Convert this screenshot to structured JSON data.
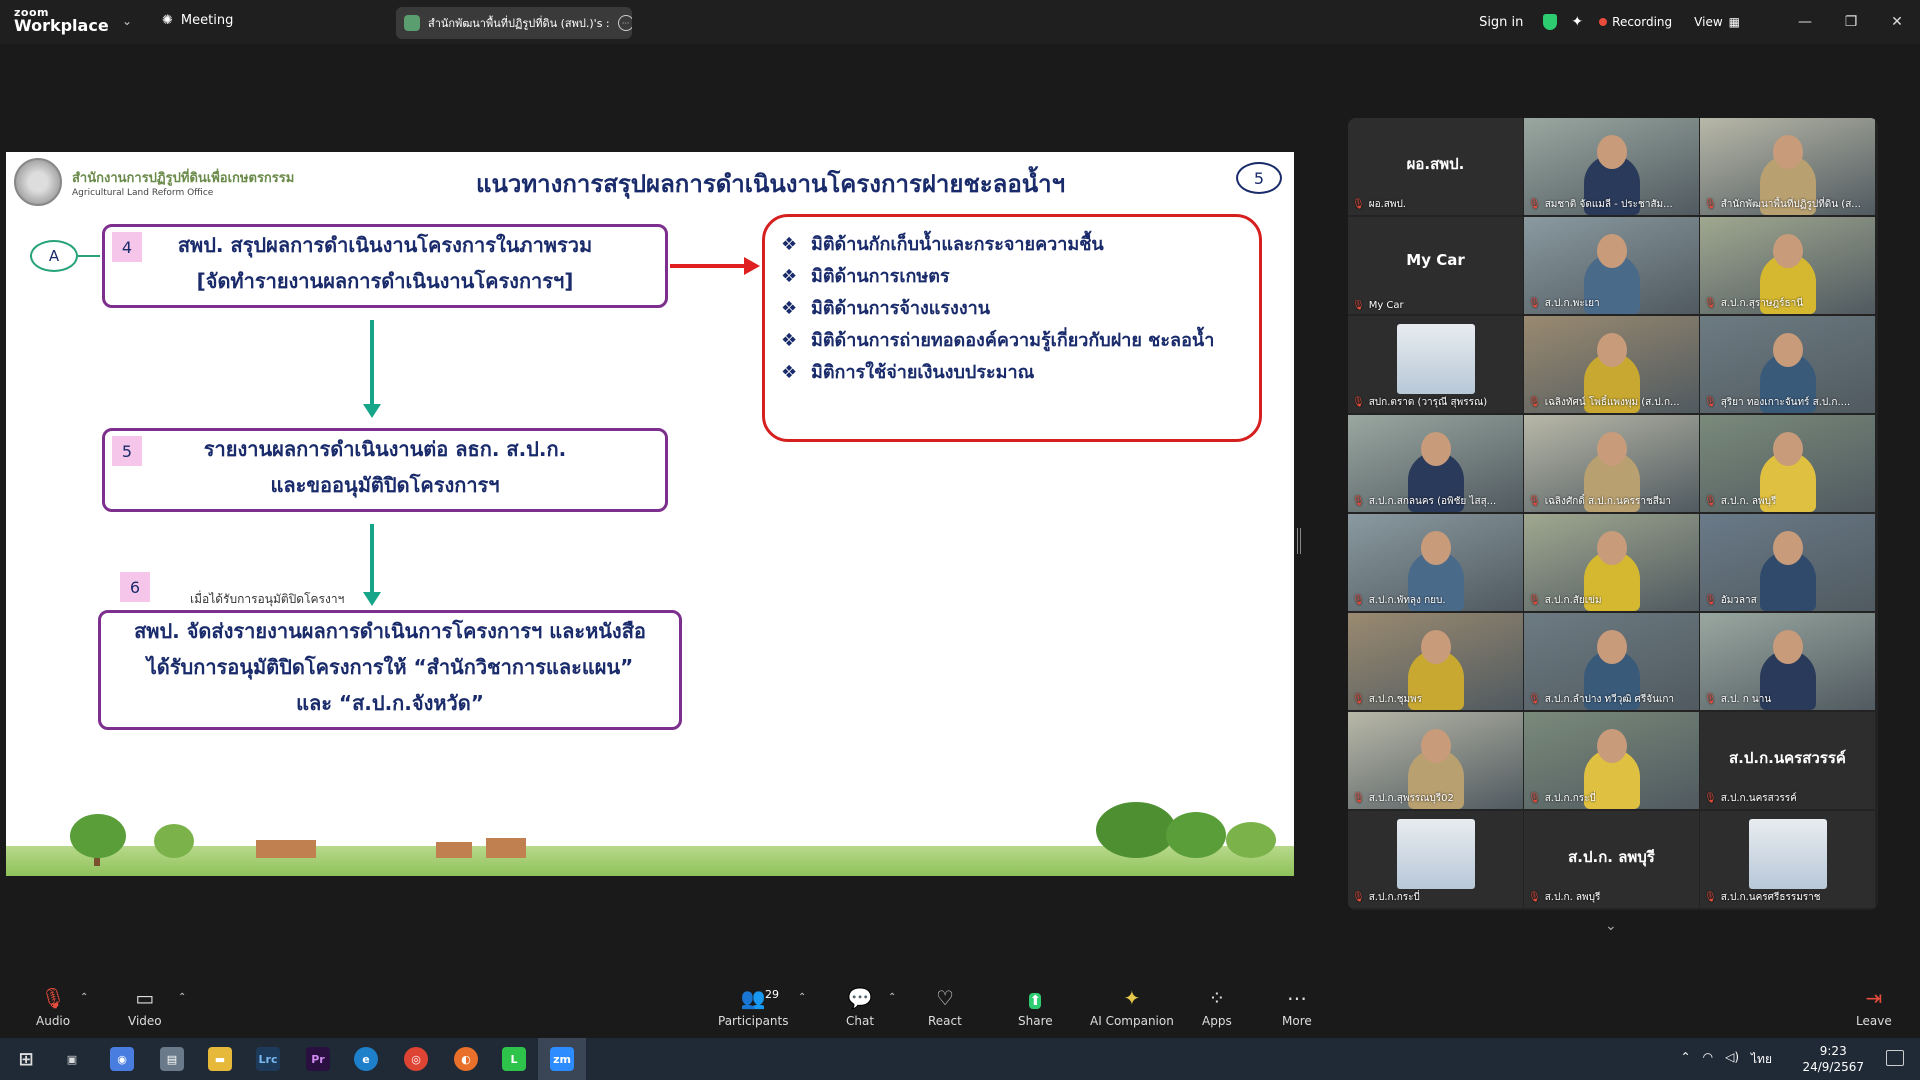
{
  "app": {
    "logo_small": "zoom",
    "logo_big": "Workplace",
    "meeting_label": "Meeting",
    "tab_title": "สำนักพัฒนาพื้นที่ปฏิรูปที่ดิน (สพป.)'s :",
    "sign_in": "Sign in",
    "recording": "Recording",
    "view": "View"
  },
  "slide": {
    "org_th": "สำนักงานการปฏิรูปที่ดินเพื่อเกษตรกรรม",
    "org_en": "Agricultural Land Reform Office",
    "title": "แนวทางการสรุปผลการดำเนินงานโครงการฝายชะลอน้ำฯ",
    "page": "5",
    "start": "A",
    "step1_num": "4",
    "step1_line1": "สพป. สรุปผลการดำเนินงานโครงการในภาพรวม",
    "step1_line2": "[จัดทำรายงานผลการดำเนินงานโครงการฯ]",
    "step2_num": "5",
    "step2_line1": "รายงานผลการดำเนินงานต่อ ลธก. ส.ป.ก.",
    "step2_line2": "และขออนุมัติปิดโครงการฯ",
    "step3_num": "6",
    "approved_note": "เมื่อได้รับการอนุมัติปิดโครงาฯ",
    "step3_line1": "สพป. จัดส่งรายงานผลการดำเนินการโครงการฯ และหนังสือ",
    "step3_line2": "ได้รับการอนุมัติปิดโครงการให้ “สำนักวิชาการและแผน”",
    "step3_line3": "และ “ส.ป.ก.จังหวัด”",
    "dimensions": [
      "มิติด้านกักเก็บน้ำและกระจายความชื้น",
      "มิติด้านการเกษตร",
      "มิติด้านการจ้างแรงงาน",
      "มิติด้านการถ่ายทอดองค์ความรู้เกี่ยวกับฝาย ชะลอน้ำ",
      "มิติการใช้จ่ายเงินงบประมาณ"
    ]
  },
  "gallery": {
    "tiles": [
      {
        "name": "ผอ.สพป.",
        "big": "ผอ.สพป."
      },
      {
        "name": "สมชาติ จัดแมลี - ประชาสัม...",
        "big": ""
      },
      {
        "name": "สำนักพัฒนาพื้นที่ปฏิรูปที่ดิน (ส...",
        "big": ""
      },
      {
        "name": "My   Car",
        "big": "My   Car"
      },
      {
        "name": "ส.ป.ก.พะเยา",
        "big": ""
      },
      {
        "name": "ส.ป.ก.สุราษฎร์ธานี",
        "big": ""
      },
      {
        "name": "สปก.ตราด (วารุณี สุพรรณ)",
        "big": ""
      },
      {
        "name": "เฉลิงทัศน์ โพธิ์แพงพุม (ส.ป.ก...",
        "big": ""
      },
      {
        "name": "สุริยา ทองเกาะจันทร์ ส.ป.ก....",
        "big": ""
      },
      {
        "name": "ส.ป.ก.สกลนคร (อพิชัย  ไสสุ...",
        "big": ""
      },
      {
        "name": "เฉลิงศักดิ์ ส.ป.ก.นครราชสีมา",
        "big": ""
      },
      {
        "name": "ส.ป.ก. ลพบุรี",
        "big": ""
      },
      {
        "name": "ส.ป.ก.พัทลุง กยบ.",
        "big": ""
      },
      {
        "name": "ส.ป.ก.สัยเข่ม",
        "big": ""
      },
      {
        "name": "อัมวลาส",
        "big": ""
      },
      {
        "name": "ส.ป.ก.ชุมพร",
        "big": ""
      },
      {
        "name": "ส.ป.ก.ลำปาง ทวีวุฒิ ศรีจันเกา",
        "big": ""
      },
      {
        "name": "ส.ป. ก นาน",
        "big": ""
      },
      {
        "name": "ส.ป.ก.สุพรรณบุรี02",
        "big": ""
      },
      {
        "name": "ส.ป.ก.กระบี่",
        "big": ""
      },
      {
        "name": "ส.ป.ก.นครสวรรค์",
        "big": "ส.ป.ก.นครสวรรค์"
      },
      {
        "name": "ส.ป.ก.กระบี่",
        "big": ""
      },
      {
        "name": "ส.ป.ก. ลพบุรี",
        "big": "ส.ป.ก. ลพบุรี"
      },
      {
        "name": "ส.ป.ก.นครศรีธรรมราช",
        "big": ""
      }
    ]
  },
  "toolbar": {
    "audio": "Audio",
    "video": "Video",
    "participants": "Participants",
    "participant_count": "29",
    "chat": "Chat",
    "react": "React",
    "share": "Share",
    "ai": "AI Companion",
    "apps": "Apps",
    "more": "More",
    "leave": "Leave"
  },
  "taskbar": {
    "lang": "ไทย",
    "time": "9:23",
    "date": "24/9/2567"
  },
  "colors": {
    "recording": "#e74c3c",
    "share": "#2ecc71",
    "active_speaker": "#2ecc71",
    "slide_title": "#1a2b6b",
    "box_border": "#7d2f8e",
    "red_box": "#d62020",
    "flow_arrow": "#17a589"
  }
}
